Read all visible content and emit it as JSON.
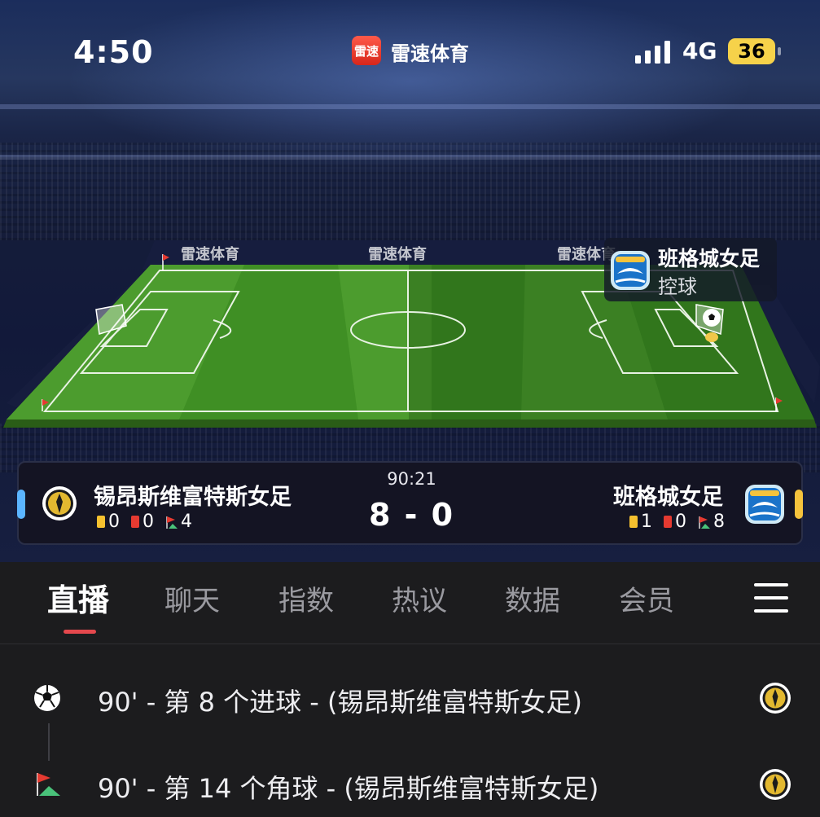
{
  "status_bar": {
    "time": "4:50",
    "app_name": "雷速体育",
    "app_logo_text": "雷速",
    "network": "4G",
    "battery": "36"
  },
  "stadium": {
    "brand_text": "雷速体育",
    "possession": {
      "team": "班格城女足",
      "status": "控球"
    }
  },
  "match": {
    "clock": "90:21",
    "score": "8 - 0",
    "home": {
      "name": "锡昂斯维富特斯女足",
      "yellow": "0",
      "red": "0",
      "corners": "4",
      "color": "#5bb5ff"
    },
    "away": {
      "name": "班格城女足",
      "yellow": "1",
      "red": "0",
      "corners": "8",
      "color": "#f5c33c"
    }
  },
  "tabs": [
    "直播",
    "聊天",
    "指数",
    "热议",
    "数据",
    "会员"
  ],
  "active_tab": "直播",
  "events": [
    {
      "icon": "soccer-ball-icon",
      "text": "90' - 第 8 个进球 - (锡昂斯维富特斯女足)"
    },
    {
      "icon": "corner-flag-icon",
      "text": "90' - 第 14 个角球 - (锡昂斯维富特斯女足)"
    }
  ]
}
